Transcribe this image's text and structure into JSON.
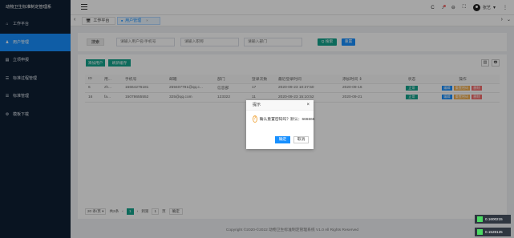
{
  "app": {
    "title": "动物卫生标准制定管理系"
  },
  "sidebar": {
    "items": [
      {
        "label": "工作平台",
        "icon": "home-icon",
        "glyph": "⌂"
      },
      {
        "label": "用户管理",
        "icon": "user-icon",
        "glyph": "♟"
      },
      {
        "label": "立项申报",
        "icon": "document-icon",
        "glyph": "▤"
      },
      {
        "label": "标准过程管理",
        "icon": "list-icon",
        "glyph": "☰"
      },
      {
        "label": "标准管理",
        "icon": "list-icon",
        "glyph": "☰"
      },
      {
        "label": "模板下载",
        "icon": "gear-icon",
        "glyph": "⚙"
      }
    ]
  },
  "header": {
    "refresh_glyph": "C",
    "bell_glyph": "♪",
    "lock_glyph": "⊖",
    "fullscreen_glyph": "⛶",
    "username": "张艺",
    "caret": "▾",
    "more_glyph": "⋮"
  },
  "tabs": {
    "left_arrow": "‹",
    "right_arrow": "›",
    "right_dropdown": "⌄",
    "items": [
      {
        "label": "工作平台",
        "glyph": "🖥"
      },
      {
        "label": "用户管理",
        "glyph": "■",
        "close": "×"
      }
    ]
  },
  "search": {
    "label": "搜索",
    "placeholder_name": "请输入用户名/手机号",
    "placeholder_title": "请输入职称",
    "placeholder_dept": "请输入部门",
    "search_btn": "Q 搜索",
    "reset_btn": "重置"
  },
  "toolbar": {
    "add_btn": "添加用户",
    "refresh_btn": "刷新缓存",
    "grid_icon": "▥",
    "print_icon": "🖶"
  },
  "table": {
    "columns": [
      "ID",
      "用...",
      "手机号",
      "邮箱",
      "部门",
      "登录次数",
      "最近登录时间",
      "添加时间 ⇕",
      "状态",
      "操作"
    ],
    "rows": [
      {
        "id": "6",
        "user": "zh...",
        "phone": "15664276181",
        "email": "259407791@qq.c...",
        "dept": "信息部",
        "logins": "17",
        "last_login": "2020-09-23 10:37:50",
        "added": "2020-09-16",
        "status": "正常"
      },
      {
        "id": "16",
        "user": "fa...",
        "phone": "15078655552",
        "email": "325@qq.com",
        "dept": "123322",
        "logins": "11",
        "last_login": "2020-09-23 15:10:52",
        "added": "2020-09-21",
        "status": "正常"
      }
    ],
    "ops": {
      "edit": "编辑",
      "reset": "重置密码",
      "delete": "删除"
    }
  },
  "pager": {
    "page_size": "20 条/页",
    "caret": "▾",
    "total": "共2条",
    "prev": "‹",
    "current": "1",
    "next": "›",
    "goto_label": "到第",
    "goto_value": "1",
    "page_unit": "页",
    "confirm": "确定"
  },
  "footer": {
    "text": "Copyright ©2020-©2022 动物卫生标准制定管理系统 V1.0 All Rights Reserved"
  },
  "toasts": [
    "0.1600215",
    "0.1528125"
  ],
  "dialog": {
    "title": "提示",
    "close": "×",
    "icon": "?",
    "message": "确认重置密码吗？默认：666666",
    "ok": "确定",
    "cancel": "取消"
  }
}
